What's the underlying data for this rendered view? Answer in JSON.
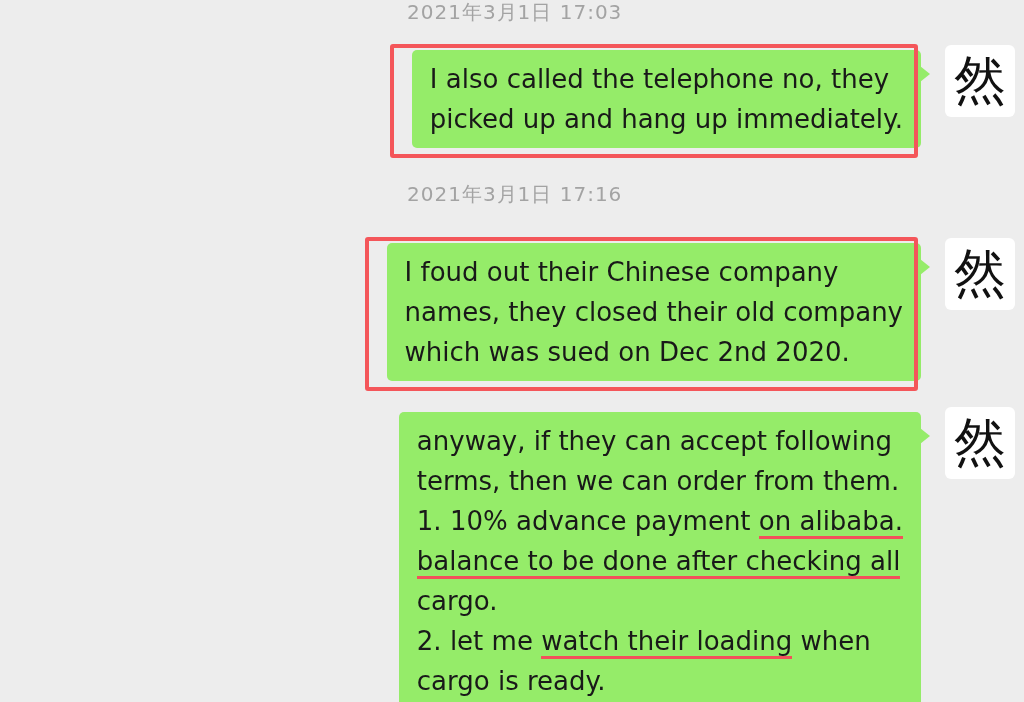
{
  "messages": [
    {
      "kind": "timestamp",
      "text": "2021年3月1日 17:03"
    },
    {
      "kind": "message",
      "highlighted": true,
      "avatar": "然",
      "segments": [
        {
          "text": "I also called the telephone no, they\npicked up and hang up immediately.",
          "underlined": false
        }
      ]
    },
    {
      "kind": "timestamp",
      "text": "2021年3月1日 17:16"
    },
    {
      "kind": "message",
      "highlighted": true,
      "avatar": "然",
      "segments": [
        {
          "text": "I foud out their Chinese company\nnames, they closed their old company\nwhich was sued on Dec 2nd 2020.",
          "underlined": false
        }
      ]
    },
    {
      "kind": "message",
      "highlighted": false,
      "avatar": "然",
      "segments": [
        {
          "text": "anyway, if they can accept following\nterms, then we can order from them.\n1. 10% advance payment ",
          "underlined": false
        },
        {
          "text": "on alibaba.\nbalance to be done after checking all",
          "underlined": true
        },
        {
          "text": "\ncargo.\n2. let me ",
          "underlined": false
        },
        {
          "text": "watch their loading",
          "underlined": true
        },
        {
          "text": " when\ncargo is ready.",
          "underlined": false
        }
      ]
    }
  ]
}
